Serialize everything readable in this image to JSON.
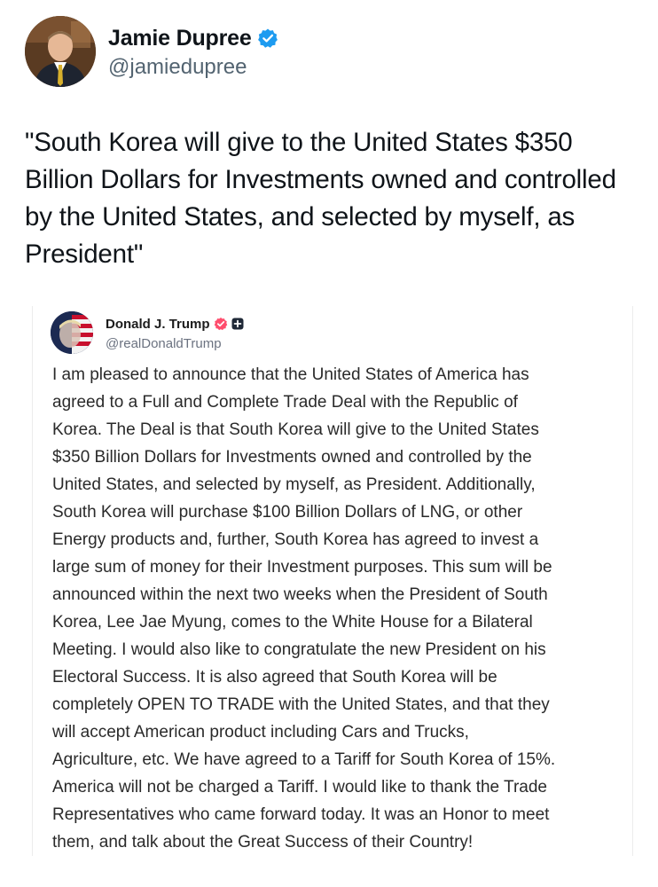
{
  "author": {
    "display_name": "Jamie Dupree",
    "handle": "@jamiedupree",
    "verified_icon": "verified-badge-icon",
    "badge_color": "#1d9bf0"
  },
  "tweet": {
    "text": "\"South Korea will give to the United States $350 Billion Dollars for Investments owned and controlled by the United States, and selected by myself, as President\""
  },
  "embedded_post": {
    "author_name": "Donald J. Trump",
    "handle": "@realDonaldTrump",
    "verified_icon": "verified-badge-icon",
    "secondary_badge_icon": "plus-badge-icon",
    "badge_color": "#ff4d6d",
    "lines": [
      "I am pleased to announce that the United States of America has",
      "agreed to a Full and Complete Trade Deal with the Republic of",
      "Korea. The Deal is that South Korea will give to the United States",
      "$350 Billion Dollars for Investments owned and controlled by the",
      "United States, and selected by myself, as President. Additionally,",
      "South Korea will purchase $100 Billion Dollars of LNG, or other",
      "Energy products and, further, South Korea has agreed to invest a",
      "large sum of money for their Investment purposes. This sum will be",
      "announced within the next two weeks when the President of South",
      "Korea, Lee Jae Myung, comes to the White House for a Bilateral",
      "Meeting. I would also like to congratulate the new President on his",
      "Electoral Success. It is also agreed that South Korea will be",
      "completely OPEN TO TRADE with the United States, and that they",
      "will accept American product including Cars and Trucks,",
      "Agriculture, etc. We have agreed to a Tariff for South Korea of 15%.",
      "America will not be charged a Tariff. I would like to thank the Trade",
      "Representatives who came forward today. It was an Honor to meet",
      "them, and talk about the Great Success of their Country!"
    ]
  }
}
